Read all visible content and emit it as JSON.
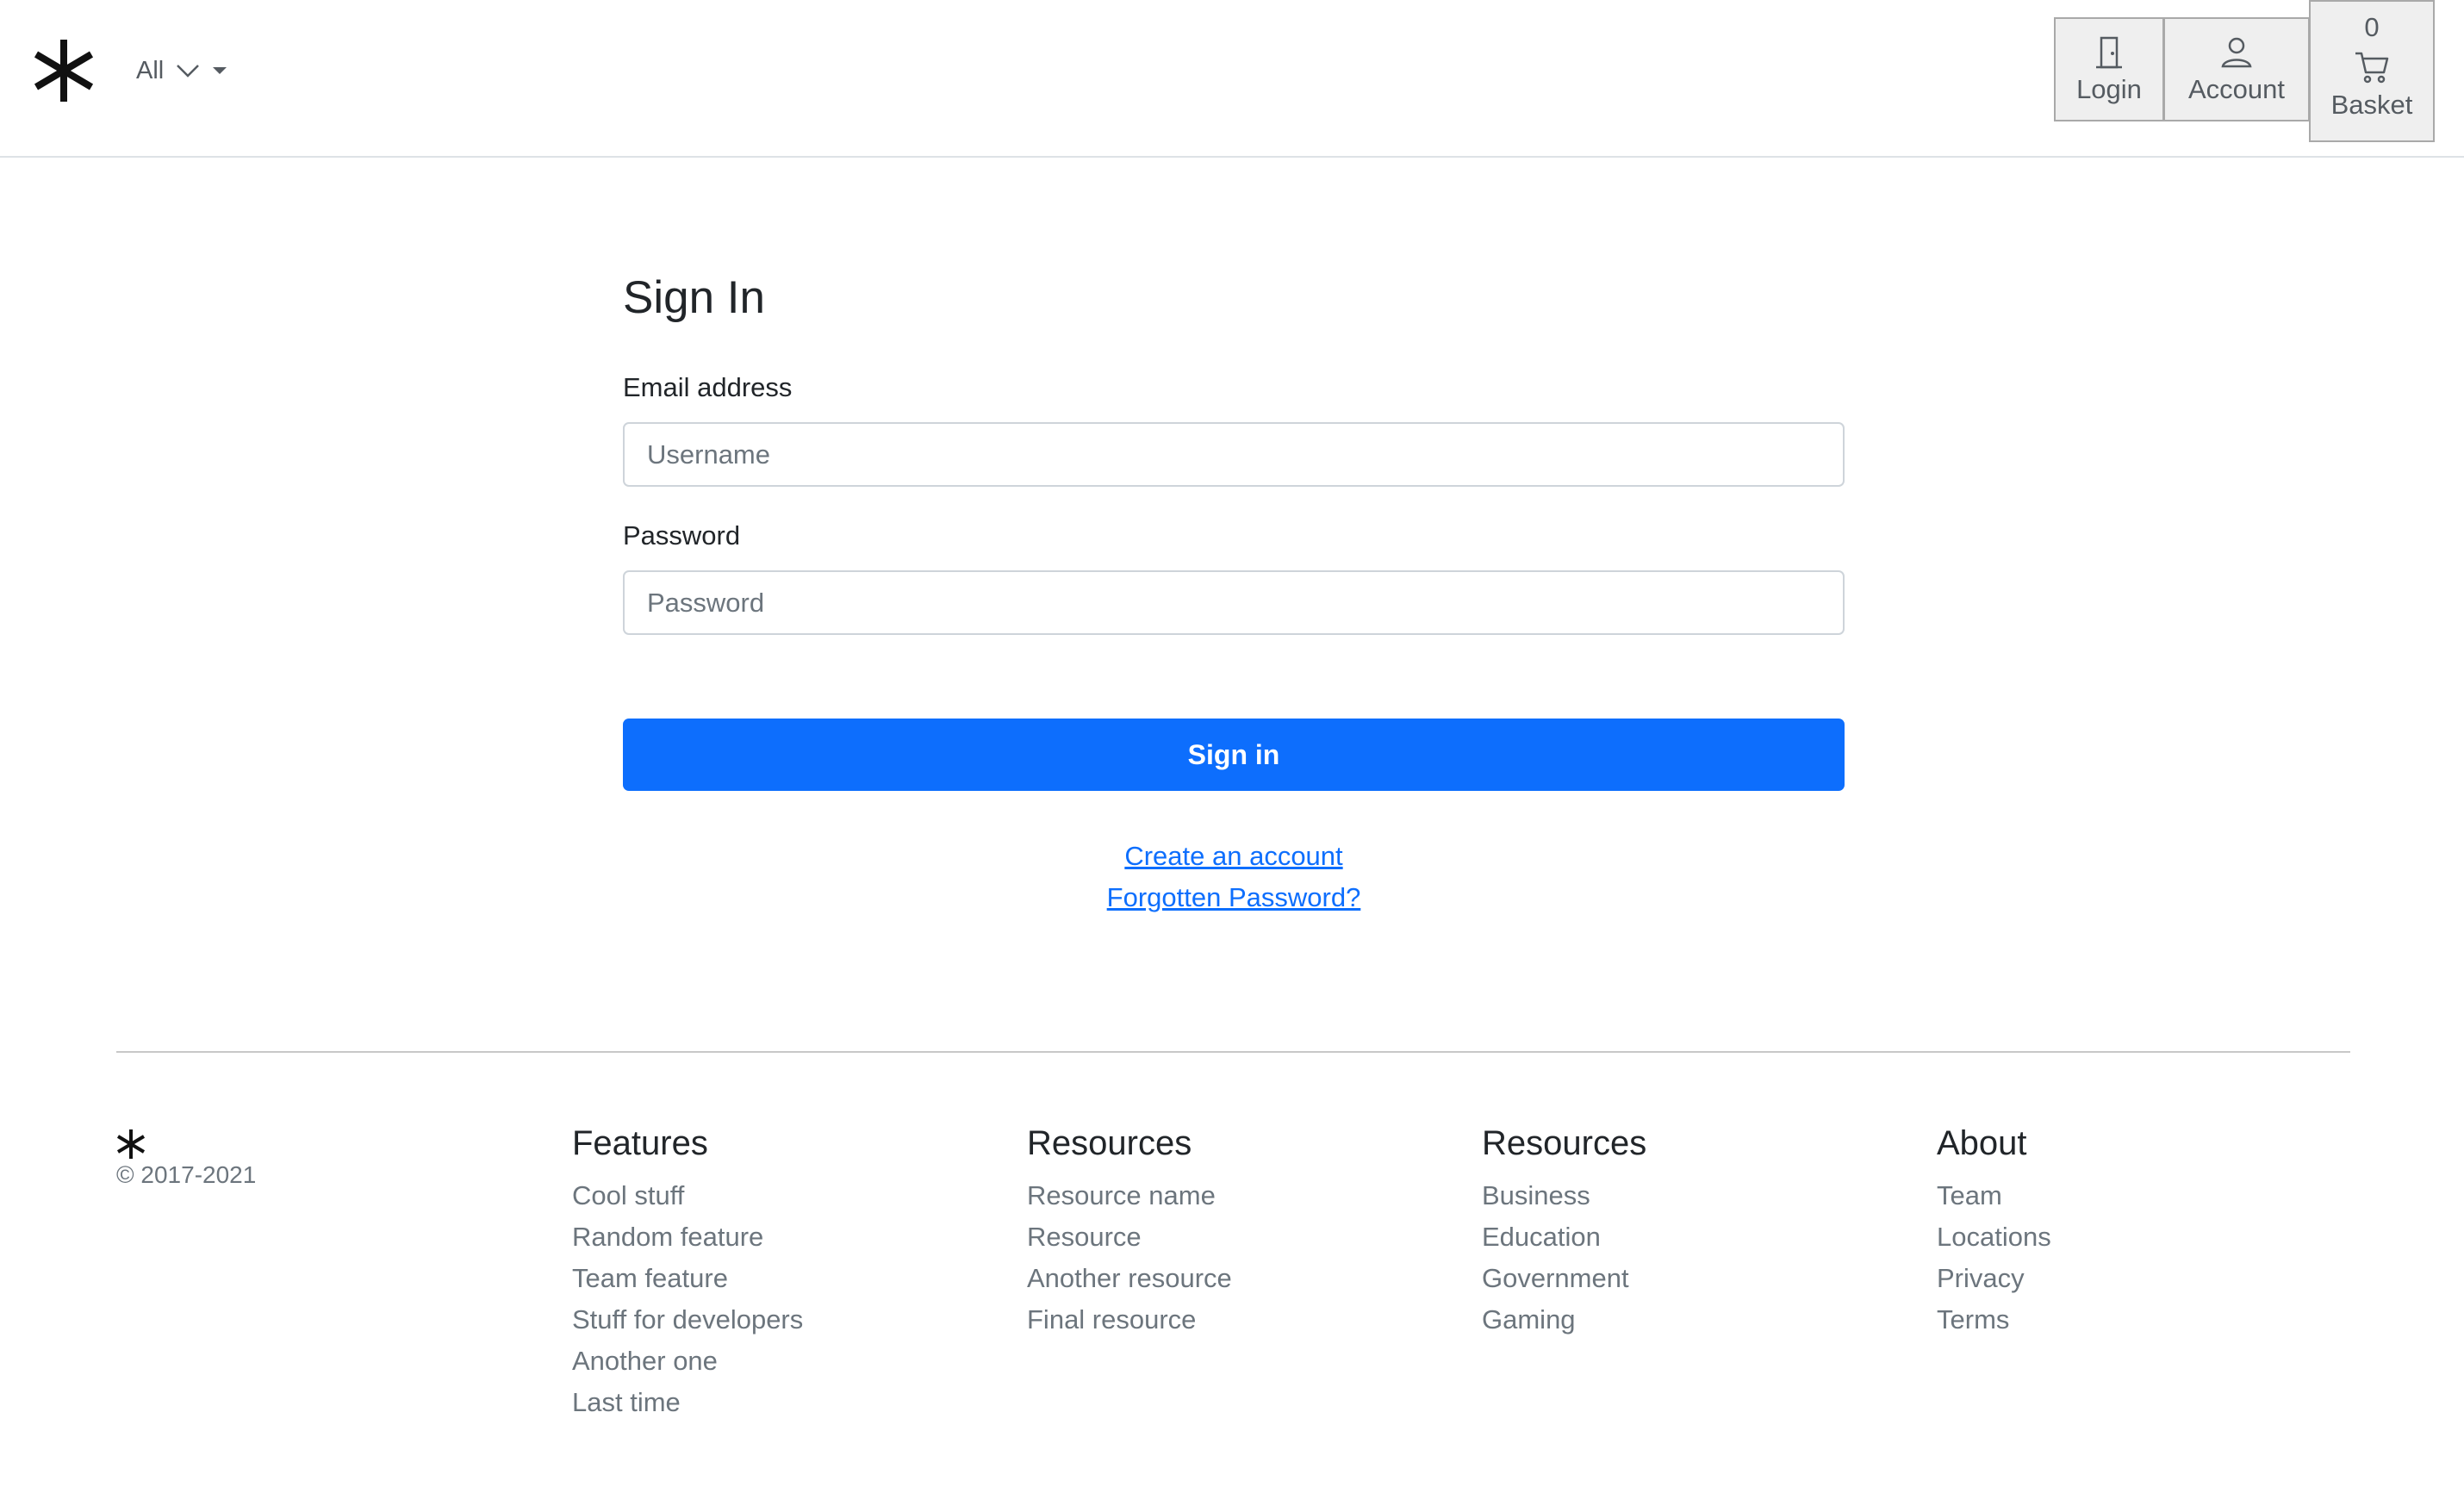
{
  "header": {
    "logo_icon": "asterisk-logo-icon",
    "category": {
      "selected": "All",
      "icon": "chevron-down-icon",
      "caret_icon": "caret-down-icon"
    },
    "login": {
      "label": "Login",
      "icon": "door-icon"
    },
    "account": {
      "label": "Account",
      "icon": "person-icon"
    },
    "basket": {
      "label": "Basket",
      "count": "0",
      "icon": "cart-icon"
    }
  },
  "signin": {
    "title": "Sign In",
    "email_label": "Email address",
    "email_placeholder": "Username",
    "email_value": "",
    "password_label": "Password",
    "password_placeholder": "Password",
    "password_value": "",
    "submit_label": "Sign in",
    "create_account": "Create an account",
    "forgot_password": "Forgotten Password?"
  },
  "colors": {
    "primary": "#0d6efd",
    "muted_text": "#6c757d",
    "button_bg": "#efefef",
    "button_border": "#a9a9a9"
  },
  "footer": {
    "logo_icon": "asterisk-logo-icon",
    "copyright": "© 2017-2021",
    "columns": [
      {
        "title": "Features",
        "items": [
          "Cool stuff",
          "Random feature",
          "Team feature",
          "Stuff for developers",
          "Another one",
          "Last time"
        ]
      },
      {
        "title": "Resources",
        "items": [
          "Resource name",
          "Resource",
          "Another resource",
          "Final resource"
        ]
      },
      {
        "title": "Resources",
        "items": [
          "Business",
          "Education",
          "Government",
          "Gaming"
        ]
      },
      {
        "title": "About",
        "items": [
          "Team",
          "Locations",
          "Privacy",
          "Terms"
        ]
      }
    ]
  }
}
